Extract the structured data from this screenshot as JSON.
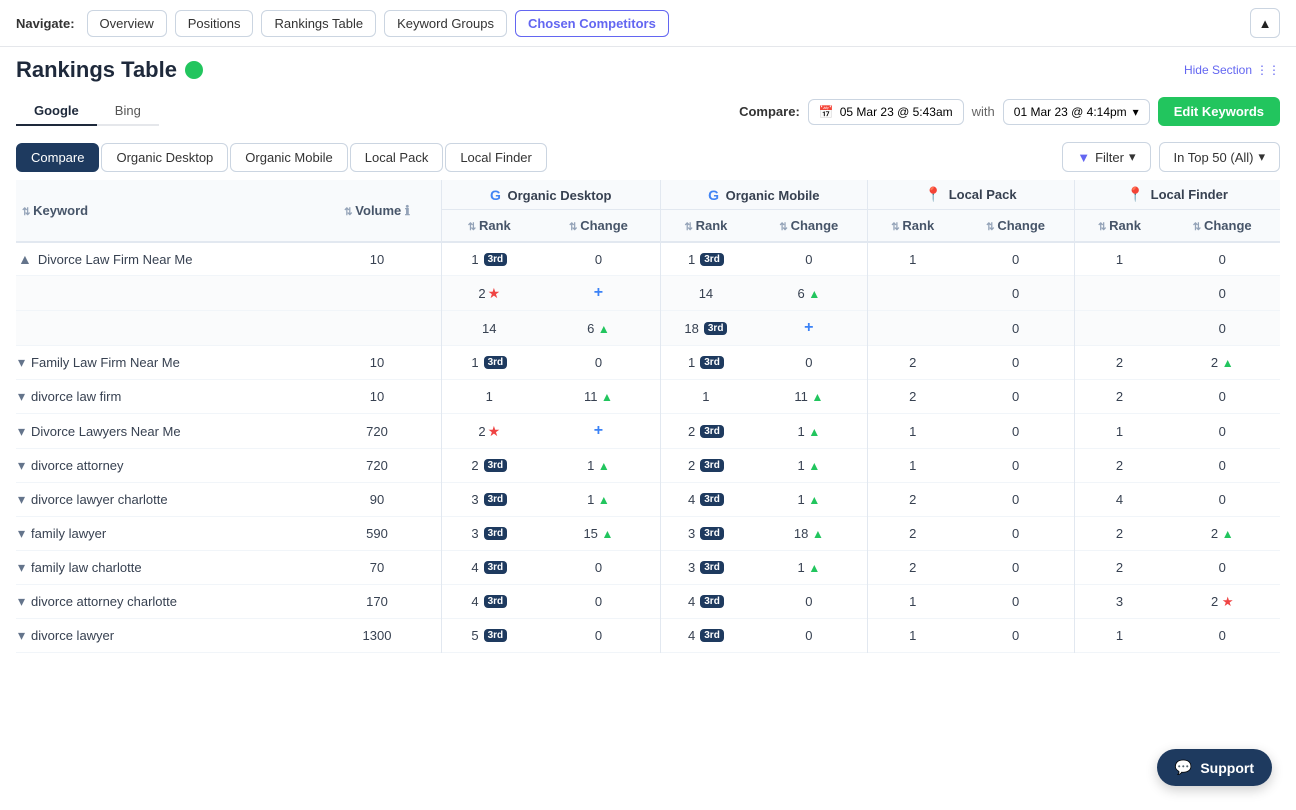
{
  "nav": {
    "label": "Navigate:",
    "buttons": [
      "Overview",
      "Positions",
      "Rankings Table",
      "Keyword Groups",
      "Chosen Competitors"
    ]
  },
  "header": {
    "title": "Rankings Table",
    "hideSection": "Hide Section"
  },
  "engineTabs": [
    "Google",
    "Bing"
  ],
  "activeEngine": "Google",
  "compare": {
    "label": "Compare:",
    "date1": "05 Mar 23 @ 5:43am",
    "with": "with",
    "date2": "01 Mar 23 @ 4:14pm",
    "editKeywords": "Edit Keywords"
  },
  "viewTabs": [
    "Compare",
    "Organic Desktop",
    "Organic Mobile",
    "Local Pack",
    "Local Finder"
  ],
  "activeViewTab": "Compare",
  "filter": {
    "filterLabel": "Filter",
    "topLabel": "In Top 50 (All)"
  },
  "tableHeaders": {
    "keyword": "Keyword",
    "volume": "Volume",
    "sections": [
      {
        "name": "Organic Desktop",
        "icon": "google"
      },
      {
        "name": "Organic Mobile",
        "icon": "google"
      },
      {
        "name": "Local Pack",
        "icon": "maps"
      },
      {
        "name": "Local Finder",
        "icon": "maps"
      }
    ],
    "subHeaders": [
      "Rank",
      "Change",
      "Rank",
      "Change",
      "Rank",
      "Change",
      "Rank",
      "Change"
    ]
  },
  "rows": [
    {
      "keyword": "Divorce Law Firm Near Me",
      "collapsed": true,
      "volume": "10",
      "od_rank": "1",
      "od_badge": "3rd",
      "od_change": "0",
      "om_rank": "1",
      "om_badge": "3rd",
      "om_change": "0",
      "lp_rank": "1",
      "lp_change": "0",
      "lf_rank": "1",
      "lf_change": "0",
      "subrows": [
        {
          "od_rank": "2",
          "od_star": true,
          "od_change": "+",
          "om_rank": "14",
          "om_change": "6up",
          "lp_rank": "",
          "lp_change": "",
          "lf_rank": "",
          "lf_change": ""
        },
        {
          "od_rank": "14",
          "od_change": "6up",
          "om_rank": "18",
          "om_badge": "3rd",
          "om_change": "+",
          "lp_rank": "",
          "lp_change": "",
          "lf_rank": "",
          "lf_change": ""
        }
      ]
    },
    {
      "keyword": "Family Law Firm Near Me",
      "collapsed": false,
      "volume": "10",
      "od_rank": "1",
      "od_badge": "3rd",
      "od_change": "0",
      "om_rank": "1",
      "om_badge": "3rd",
      "om_change": "0",
      "lp_rank": "2",
      "lp_change": "0",
      "lf_rank": "2",
      "lf_change": "2up"
    },
    {
      "keyword": "divorce law firm",
      "collapsed": false,
      "volume": "10",
      "od_rank": "1",
      "od_change": "11up",
      "om_rank": "1",
      "om_change": "11up",
      "lp_rank": "2",
      "lp_change": "0",
      "lf_rank": "2",
      "lf_change": "0"
    },
    {
      "keyword": "Divorce Lawyers Near Me",
      "collapsed": false,
      "volume": "720",
      "od_rank": "2",
      "od_star": true,
      "od_change": "+",
      "om_rank": "2",
      "om_badge": "3rd",
      "om_change": "1up",
      "lp_rank": "1",
      "lp_change": "0",
      "lf_rank": "1",
      "lf_change": "0"
    },
    {
      "keyword": "divorce attorney",
      "collapsed": false,
      "volume": "720",
      "od_rank": "2",
      "od_badge": "3rd",
      "od_change": "1up",
      "om_rank": "2",
      "om_badge": "3rd",
      "om_change": "1up",
      "lp_rank": "1",
      "lp_change": "0",
      "lf_rank": "2",
      "lf_change": "0"
    },
    {
      "keyword": "divorce lawyer charlotte",
      "collapsed": false,
      "volume": "90",
      "od_rank": "3",
      "od_badge": "3rd",
      "od_change": "1up",
      "om_rank": "4",
      "om_badge": "3rd",
      "om_change": "1up",
      "lp_rank": "2",
      "lp_change": "0",
      "lf_rank": "4",
      "lf_change": "0"
    },
    {
      "keyword": "family lawyer",
      "collapsed": false,
      "volume": "590",
      "od_rank": "3",
      "od_badge": "3rd",
      "od_change": "15up",
      "om_rank": "3",
      "om_badge": "3rd",
      "om_change": "18up",
      "lp_rank": "2",
      "lp_change": "0",
      "lf_rank": "2",
      "lf_change": "2up"
    },
    {
      "keyword": "family law charlotte",
      "collapsed": false,
      "volume": "70",
      "od_rank": "4",
      "od_badge": "3rd",
      "od_change": "0",
      "om_rank": "3",
      "om_badge": "3rd",
      "om_change": "1up",
      "lp_rank": "2",
      "lp_change": "0",
      "lf_rank": "2",
      "lf_change": "0"
    },
    {
      "keyword": "divorce attorney charlotte",
      "collapsed": false,
      "volume": "170",
      "od_rank": "4",
      "od_badge": "3rd",
      "od_change": "0",
      "om_rank": "4",
      "om_badge": "3rd",
      "om_change": "0",
      "lp_rank": "1",
      "lp_change": "0",
      "lf_rank": "3",
      "lf_change": "2red"
    },
    {
      "keyword": "divorce lawyer",
      "collapsed": false,
      "volume": "1300",
      "od_rank": "5",
      "od_badge": "3rd",
      "od_change": "0",
      "om_rank": "4",
      "om_badge": "3rd",
      "om_change": "0",
      "lp_rank": "1",
      "lp_change": "0",
      "lf_rank": "1",
      "lf_change": "0"
    }
  ],
  "support": {
    "label": "Support"
  }
}
